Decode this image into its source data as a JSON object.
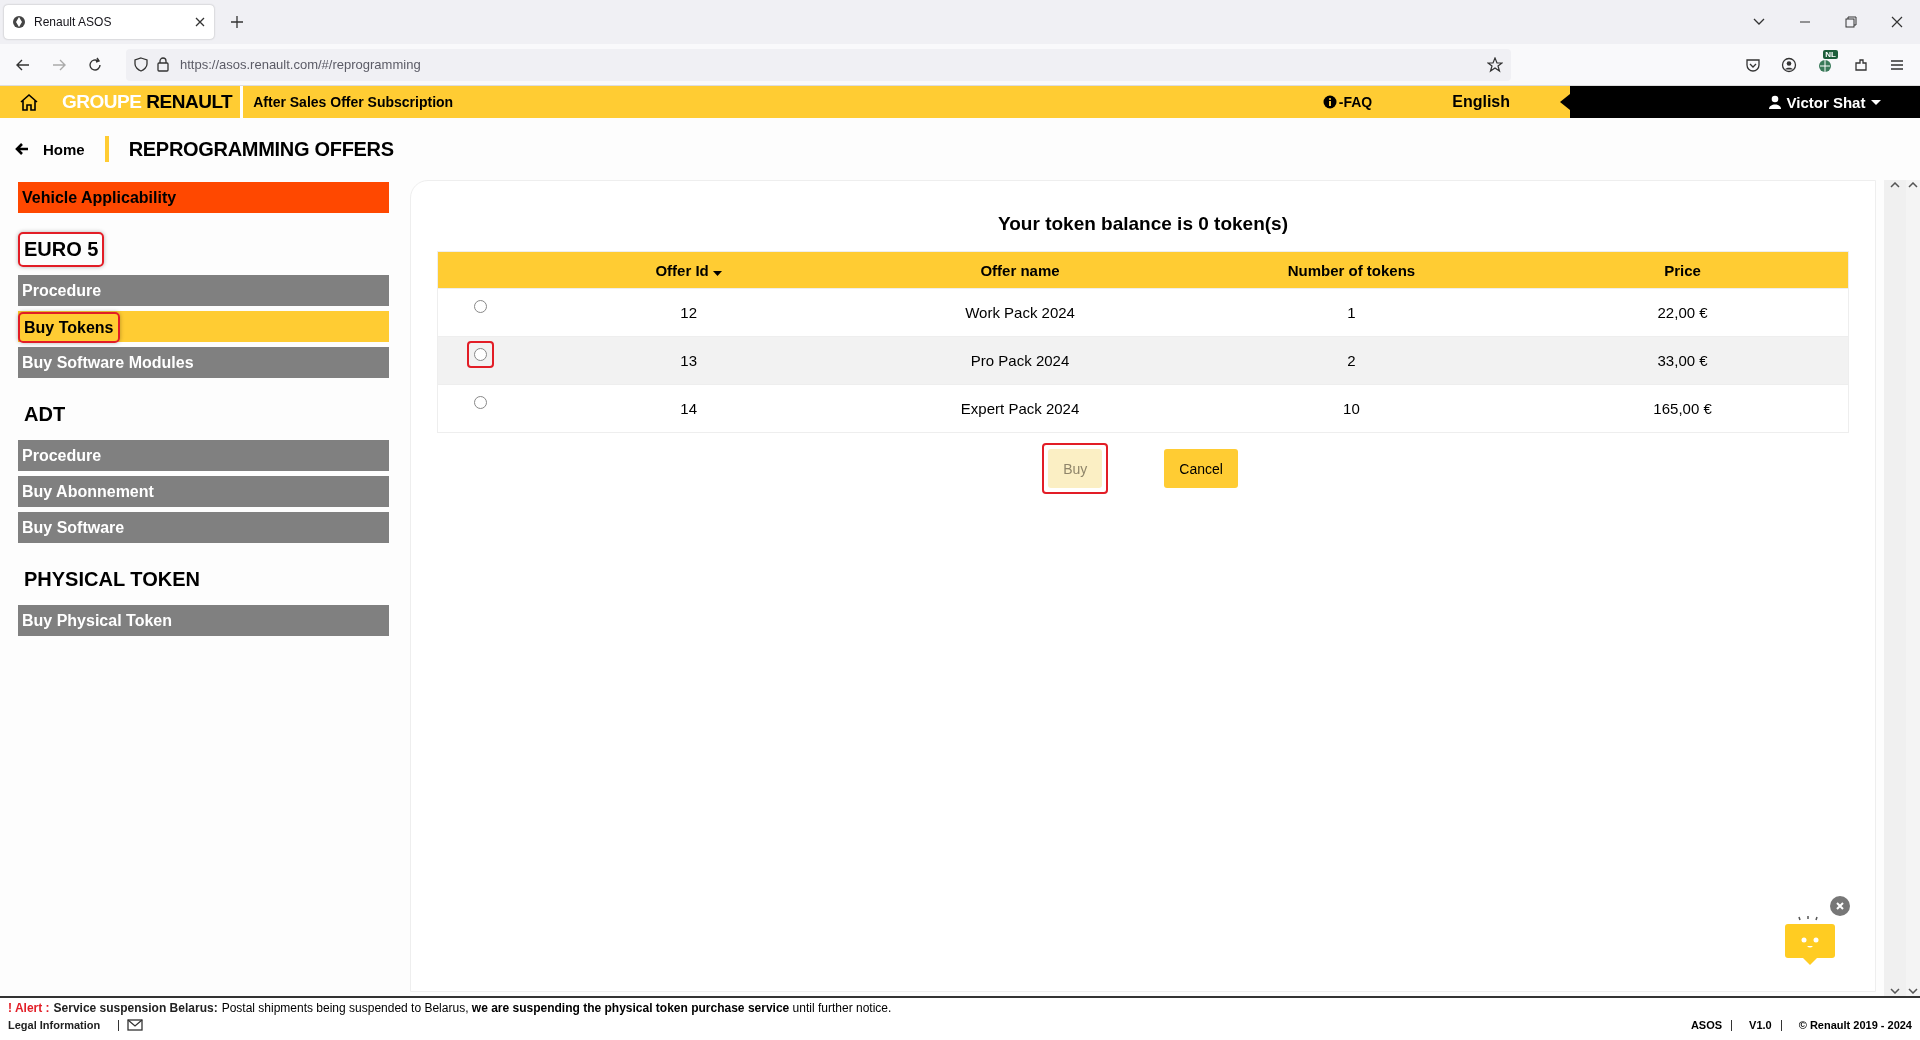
{
  "browser": {
    "tab_title": "Renault ASOS",
    "url": "https://asos.renault.com/#/reprogramming",
    "extension_badge": "NL"
  },
  "header": {
    "brand_first": "GROUPE",
    "brand_second": "RENAULT",
    "subtitle": "After Sales Offer Subscription",
    "faq": "-FAQ",
    "language": "English",
    "user": "Victor Shat"
  },
  "breadcrumb": {
    "home": "Home",
    "title": "REPROGRAMMING OFFERS"
  },
  "sidebar": {
    "top_item": "Vehicle Applicability",
    "sections": [
      {
        "title": "EURO 5",
        "highlighted": true,
        "items": [
          {
            "label": "Procedure",
            "selected": false,
            "highlighted": false
          },
          {
            "label": "Buy Tokens",
            "selected": true,
            "highlighted": true
          },
          {
            "label": "Buy Software Modules",
            "selected": false,
            "highlighted": false
          }
        ]
      },
      {
        "title": "ADT",
        "highlighted": false,
        "items": [
          {
            "label": "Procedure",
            "selected": false,
            "highlighted": false
          },
          {
            "label": "Buy Abonnement",
            "selected": false,
            "highlighted": false
          },
          {
            "label": "Buy Software",
            "selected": false,
            "highlighted": false
          }
        ]
      },
      {
        "title": "PHYSICAL TOKEN",
        "highlighted": false,
        "items": [
          {
            "label": "Buy Physical Token",
            "selected": false,
            "highlighted": false
          }
        ]
      }
    ]
  },
  "offers": {
    "balance": "Your token balance is 0 token(s)",
    "columns": [
      {
        "label": "Offer Id",
        "sorted": true
      },
      {
        "label": "Offer name",
        "sorted": false
      },
      {
        "label": "Number of tokens",
        "sorted": false
      },
      {
        "label": "Price",
        "sorted": false
      }
    ],
    "rows": [
      {
        "selected": false,
        "highlighted": false,
        "cells": [
          "12",
          "Work Pack 2024",
          "1",
          "22,00 €"
        ]
      },
      {
        "selected": false,
        "highlighted": true,
        "cells": [
          "13",
          "Pro Pack 2024",
          "2",
          "33,00 €"
        ]
      },
      {
        "selected": false,
        "highlighted": false,
        "cells": [
          "14",
          "Expert Pack 2024",
          "10",
          "165,00 €"
        ]
      }
    ],
    "buttons": [
      {
        "label": "Buy",
        "disabled": true,
        "highlighted": true
      },
      {
        "label": "Cancel",
        "disabled": false,
        "highlighted": false
      }
    ]
  },
  "footer": {
    "alert_mark": "! Alert :",
    "alert_title": "Service suspension Belarus:",
    "alert_text": "Postal shipments being suspended to Belarus, **we are suspending the physical token purchase service** until further notice.",
    "legal": "Legal Information",
    "app": "ASOS",
    "version": "V1.0",
    "copyright": "© Renault 2019 - 2024"
  }
}
